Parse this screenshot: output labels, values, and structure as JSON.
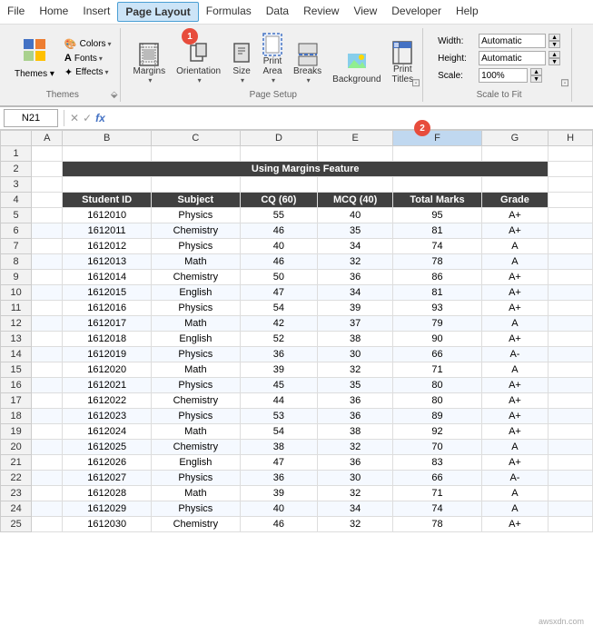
{
  "menuBar": {
    "items": [
      "File",
      "Home",
      "Insert",
      "Page Layout",
      "Formulas",
      "Data",
      "Review",
      "View",
      "Developer",
      "Help"
    ]
  },
  "ribbon": {
    "groups": [
      {
        "id": "themes",
        "label": "Themes",
        "items": [
          {
            "id": "themes-btn",
            "icon": "🎨",
            "label": "Themes"
          },
          {
            "id": "colors",
            "icon": "🎨",
            "label": "Colors ▾"
          },
          {
            "id": "fonts",
            "icon": "A",
            "label": "Fonts ▾"
          },
          {
            "id": "effects",
            "icon": "✨",
            "label": "Effects ▾"
          }
        ]
      },
      {
        "id": "page-setup",
        "label": "Page Setup",
        "items": [
          {
            "id": "margins",
            "icon": "▤",
            "label": "Margins"
          },
          {
            "id": "orientation",
            "icon": "⬜",
            "label": "Orientation"
          },
          {
            "id": "size",
            "icon": "📄",
            "label": "Size"
          },
          {
            "id": "print-area",
            "icon": "▦",
            "label": "Print Area"
          },
          {
            "id": "breaks",
            "icon": "⊞",
            "label": "Breaks"
          },
          {
            "id": "background",
            "icon": "🖼",
            "label": "Background"
          },
          {
            "id": "print-titles",
            "icon": "🖨",
            "label": "Print Titles"
          }
        ]
      },
      {
        "id": "scale-to-fit",
        "label": "Scale to Fit",
        "rows": [
          {
            "label": "Width:",
            "value": "Automatic"
          },
          {
            "label": "Height:",
            "value": "Automatic"
          },
          {
            "label": "Scale:",
            "value": "100%"
          }
        ]
      }
    ],
    "badge1": "1",
    "badge2": "2"
  },
  "formulaBar": {
    "cellRef": "N21",
    "formula": ""
  },
  "sheet": {
    "title": "Using Margins Feature",
    "columns": [
      "",
      "A",
      "B",
      "C",
      "D",
      "E",
      "F",
      "G",
      "H"
    ],
    "headers": [
      "Student ID",
      "Subject",
      "CQ (60)",
      "MCQ (40)",
      "Total Marks",
      "Grade"
    ],
    "rows": [
      {
        "id": 5,
        "studentId": "1612010",
        "subject": "Physics",
        "cq": 55,
        "mcq": 40,
        "total": 95,
        "grade": "A+"
      },
      {
        "id": 6,
        "studentId": "1612011",
        "subject": "Chemistry",
        "cq": 46,
        "mcq": 35,
        "total": 81,
        "grade": "A+"
      },
      {
        "id": 7,
        "studentId": "1612012",
        "subject": "Physics",
        "cq": 40,
        "mcq": 34,
        "total": 74,
        "grade": "A"
      },
      {
        "id": 8,
        "studentId": "1612013",
        "subject": "Math",
        "cq": 46,
        "mcq": 32,
        "total": 78,
        "grade": "A"
      },
      {
        "id": 9,
        "studentId": "1612014",
        "subject": "Chemistry",
        "cq": 50,
        "mcq": 36,
        "total": 86,
        "grade": "A+"
      },
      {
        "id": 10,
        "studentId": "1612015",
        "subject": "English",
        "cq": 47,
        "mcq": 34,
        "total": 81,
        "grade": "A+"
      },
      {
        "id": 11,
        "studentId": "1612016",
        "subject": "Physics",
        "cq": 54,
        "mcq": 39,
        "total": 93,
        "grade": "A+"
      },
      {
        "id": 12,
        "studentId": "1612017",
        "subject": "Math",
        "cq": 42,
        "mcq": 37,
        "total": 79,
        "grade": "A"
      },
      {
        "id": 13,
        "studentId": "1612018",
        "subject": "English",
        "cq": 52,
        "mcq": 38,
        "total": 90,
        "grade": "A+"
      },
      {
        "id": 14,
        "studentId": "1612019",
        "subject": "Physics",
        "cq": 36,
        "mcq": 30,
        "total": 66,
        "grade": "A-"
      },
      {
        "id": 15,
        "studentId": "1612020",
        "subject": "Math",
        "cq": 39,
        "mcq": 32,
        "total": 71,
        "grade": "A"
      },
      {
        "id": 16,
        "studentId": "1612021",
        "subject": "Physics",
        "cq": 45,
        "mcq": 35,
        "total": 80,
        "grade": "A+"
      },
      {
        "id": 17,
        "studentId": "1612022",
        "subject": "Chemistry",
        "cq": 44,
        "mcq": 36,
        "total": 80,
        "grade": "A+"
      },
      {
        "id": 18,
        "studentId": "1612023",
        "subject": "Physics",
        "cq": 53,
        "mcq": 36,
        "total": 89,
        "grade": "A+"
      },
      {
        "id": 19,
        "studentId": "1612024",
        "subject": "Math",
        "cq": 54,
        "mcq": 38,
        "total": 92,
        "grade": "A+"
      },
      {
        "id": 20,
        "studentId": "1612025",
        "subject": "Chemistry",
        "cq": 38,
        "mcq": 32,
        "total": 70,
        "grade": "A"
      },
      {
        "id": 21,
        "studentId": "1612026",
        "subject": "English",
        "cq": 47,
        "mcq": 36,
        "total": 83,
        "grade": "A+"
      },
      {
        "id": 22,
        "studentId": "1612027",
        "subject": "Physics",
        "cq": 36,
        "mcq": 30,
        "total": 66,
        "grade": "A-"
      },
      {
        "id": 23,
        "studentId": "1612028",
        "subject": "Math",
        "cq": 39,
        "mcq": 32,
        "total": 71,
        "grade": "A"
      },
      {
        "id": 24,
        "studentId": "1612029",
        "subject": "Physics",
        "cq": 40,
        "mcq": 34,
        "total": 74,
        "grade": "A"
      },
      {
        "id": 25,
        "studentId": "1612030",
        "subject": "Chemistry",
        "cq": 46,
        "mcq": 32,
        "total": 78,
        "grade": "A+"
      }
    ]
  },
  "watermark": "awsxdn.com"
}
